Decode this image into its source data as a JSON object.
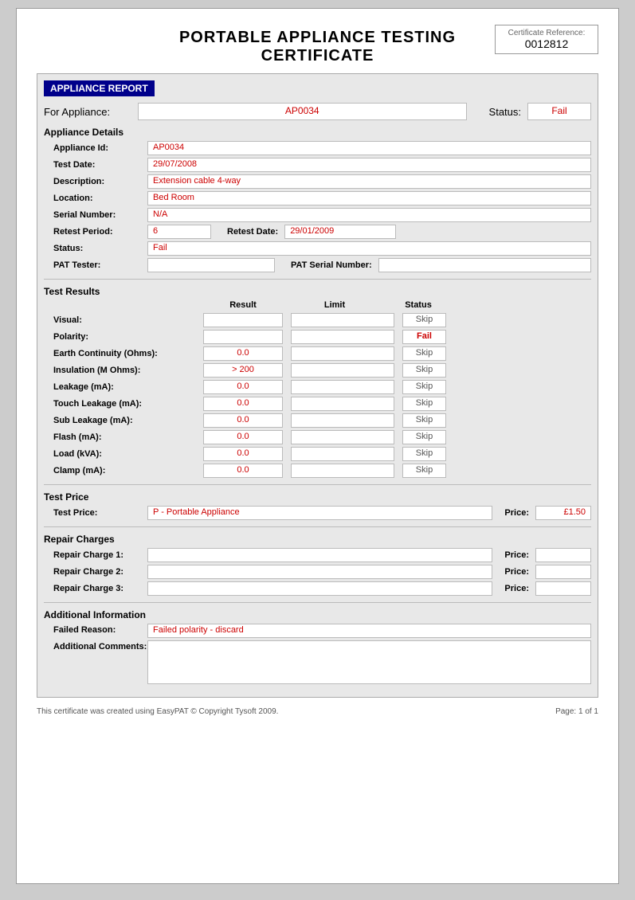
{
  "page": {
    "title": "PORTABLE APPLIANCE TESTING CERTIFICATE",
    "cert_ref_label": "Certificate Reference:",
    "cert_ref_number": "0012812"
  },
  "appliance_report": {
    "section_label": "APPLIANCE REPORT",
    "for_appliance_label": "For Appliance:",
    "appliance_id_field": "AP0034",
    "status_label": "Status:",
    "status_value": "Fail",
    "details_title": "Appliance Details",
    "fields": {
      "appliance_id_label": "Appliance Id:",
      "appliance_id_value": "AP0034",
      "test_date_label": "Test Date:",
      "test_date_value": "29/07/2008",
      "description_label": "Description:",
      "description_value": "Extension cable 4-way",
      "location_label": "Location:",
      "location_value": "Bed Room",
      "serial_number_label": "Serial Number:",
      "serial_number_value": "N/A",
      "retest_period_label": "Retest Period:",
      "retest_period_value": "6",
      "retest_date_label": "Retest Date:",
      "retest_date_value": "29/01/2009",
      "status_label": "Status:",
      "status_value": "Fail",
      "pat_tester_label": "PAT Tester:",
      "pat_tester_value": "",
      "pat_serial_label": "PAT Serial Number:",
      "pat_serial_value": ""
    }
  },
  "test_results": {
    "section_title": "Test Results",
    "col_result": "Result",
    "col_limit": "Limit",
    "col_status": "Status",
    "rows": [
      {
        "label": "Visual:",
        "result": "",
        "limit": "",
        "status": "Skip",
        "status_class": "skip"
      },
      {
        "label": "Polarity:",
        "result": "",
        "limit": "",
        "status": "Fail",
        "status_class": "fail"
      },
      {
        "label": "Earth Continuity (Ohms):",
        "result": "0.0",
        "limit": "",
        "status": "Skip",
        "status_class": "skip"
      },
      {
        "label": "Insulation (M Ohms):",
        "result": "> 200",
        "limit": "",
        "status": "Skip",
        "status_class": "skip"
      },
      {
        "label": "Leakage (mA):",
        "result": "0.0",
        "limit": "",
        "status": "Skip",
        "status_class": "skip"
      },
      {
        "label": "Touch Leakage (mA):",
        "result": "0.0",
        "limit": "",
        "status": "Skip",
        "status_class": "skip"
      },
      {
        "label": "Sub Leakage (mA):",
        "result": "0.0",
        "limit": "",
        "status": "Skip",
        "status_class": "skip"
      },
      {
        "label": "Flash (mA):",
        "result": "0.0",
        "limit": "",
        "status": "Skip",
        "status_class": "skip"
      },
      {
        "label": "Load (kVA):",
        "result": "0.0",
        "limit": "",
        "status": "Skip",
        "status_class": "skip"
      },
      {
        "label": "Clamp (mA):",
        "result": "0.0",
        "limit": "",
        "status": "Skip",
        "status_class": "skip"
      }
    ]
  },
  "test_price": {
    "section_title": "Test Price",
    "label": "Test Price:",
    "desc_value": "P - Portable Appliance",
    "price_label": "Price:",
    "price_value": "£1.50"
  },
  "repair_charges": {
    "section_title": "Repair Charges",
    "rows": [
      {
        "label": "Repair Charge 1:",
        "desc": "",
        "price_label": "Price:",
        "price": ""
      },
      {
        "label": "Repair Charge 2:",
        "desc": "",
        "price_label": "Price:",
        "price": ""
      },
      {
        "label": "Repair Charge 3:",
        "desc": "",
        "price_label": "Price:",
        "price": ""
      }
    ]
  },
  "additional_info": {
    "section_title": "Additional Information",
    "failed_reason_label": "Failed Reason:",
    "failed_reason_value": "Failed polarity - discard",
    "additional_comments_label": "Additional Comments:",
    "additional_comments_value": ""
  },
  "footer": {
    "left_text": "This certificate was created using EasyPAT © Copyright Tysoft 2009.",
    "right_text": "Page: 1 of 1"
  }
}
